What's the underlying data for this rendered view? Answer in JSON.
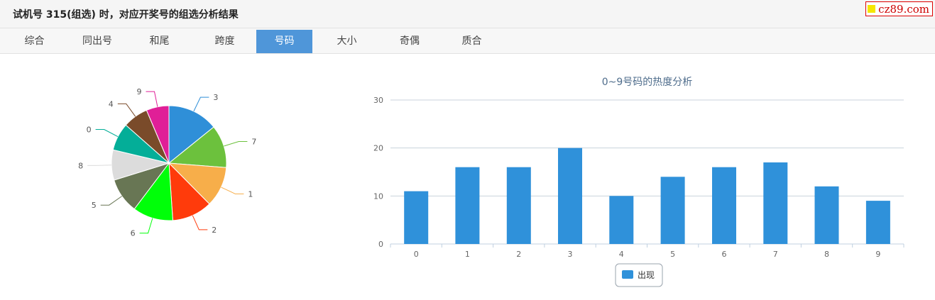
{
  "header": {
    "title": "试机号 315(组选) 时，对应开奖号的组选分析结果",
    "logo_text": "cz89.com"
  },
  "tabs": [
    {
      "label": "综合",
      "active": false
    },
    {
      "label": "同出号",
      "active": false
    },
    {
      "label": "和尾",
      "active": false
    },
    {
      "label": "跨度",
      "active": false
    },
    {
      "label": "号码",
      "active": true
    },
    {
      "label": "大小",
      "active": false
    },
    {
      "label": "奇偶",
      "active": false
    },
    {
      "label": "质合",
      "active": false
    }
  ],
  "chart_data": [
    {
      "type": "pie",
      "labels": [
        "3",
        "7",
        "1",
        "2",
        "6",
        "5",
        "8",
        "0",
        "4",
        "9"
      ],
      "values": [
        20,
        17,
        16,
        16,
        16,
        14,
        12,
        11,
        10,
        9
      ],
      "colors": [
        "#2f8fd8",
        "#6cc13d",
        "#f7ae4a",
        "#ff3b0b",
        "#00ff09",
        "#687654",
        "#dcdcdc",
        "#04ae98",
        "#7a4b2a",
        "#e01f97"
      ]
    },
    {
      "type": "bar",
      "title": "0~9号码的热度分析",
      "categories": [
        "0",
        "1",
        "2",
        "3",
        "4",
        "5",
        "6",
        "7",
        "8",
        "9"
      ],
      "series": [
        {
          "name": "出现",
          "values": [
            11,
            16,
            16,
            20,
            10,
            14,
            16,
            17,
            12,
            9
          ],
          "color": "#2f91da"
        }
      ],
      "ylim": [
        0,
        30
      ],
      "yticks": [
        0,
        10,
        20,
        30
      ],
      "grid": true,
      "legend": "bottom-center"
    }
  ]
}
